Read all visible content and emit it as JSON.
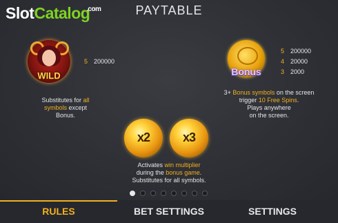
{
  "logo": {
    "slot": "Slot",
    "catalog": "Catalog",
    "com": ".com"
  },
  "title": "PAYTABLE",
  "wild": {
    "symbol_word": "WILD",
    "pays": [
      {
        "count": "5",
        "value": "200000"
      }
    ],
    "desc": {
      "line1_a": "Substitutes for ",
      "line1_b": "all",
      "line2_a": "symbols",
      "line2_b": " except",
      "line3": "Bonus."
    }
  },
  "bonus": {
    "symbol_word": "Bonus",
    "pays": [
      {
        "count": "5",
        "value": "200000"
      },
      {
        "count": "4",
        "value": "20000"
      },
      {
        "count": "3",
        "value": "2000"
      }
    ],
    "desc": {
      "line1_a": "3+ ",
      "line1_b": "Bonus symbols",
      "line1_c": " on the screen",
      "line2_a": "trigger ",
      "line2_b": "10 Free Spins",
      "line2_c": ".",
      "line3": "Plays anywhere",
      "line4": "on the screen."
    }
  },
  "multipliers": {
    "items": [
      "x2",
      "x3"
    ],
    "desc": {
      "line1_a": "Activates ",
      "line1_b": "win multiplier",
      "line2_a": "during the ",
      "line2_b": "bonus game",
      "line2_c": ".",
      "line3": "Substitutes for all symbols."
    }
  },
  "pagination": {
    "count": 8,
    "active": 0
  },
  "tabs": [
    {
      "label": "RULES",
      "active": true
    },
    {
      "label": "BET SETTINGS",
      "active": false
    },
    {
      "label": "SETTINGS",
      "active": false
    }
  ],
  "colors": {
    "accent": "#f2b01e",
    "logo_green": "#7ed321",
    "background": "#2e3036"
  }
}
